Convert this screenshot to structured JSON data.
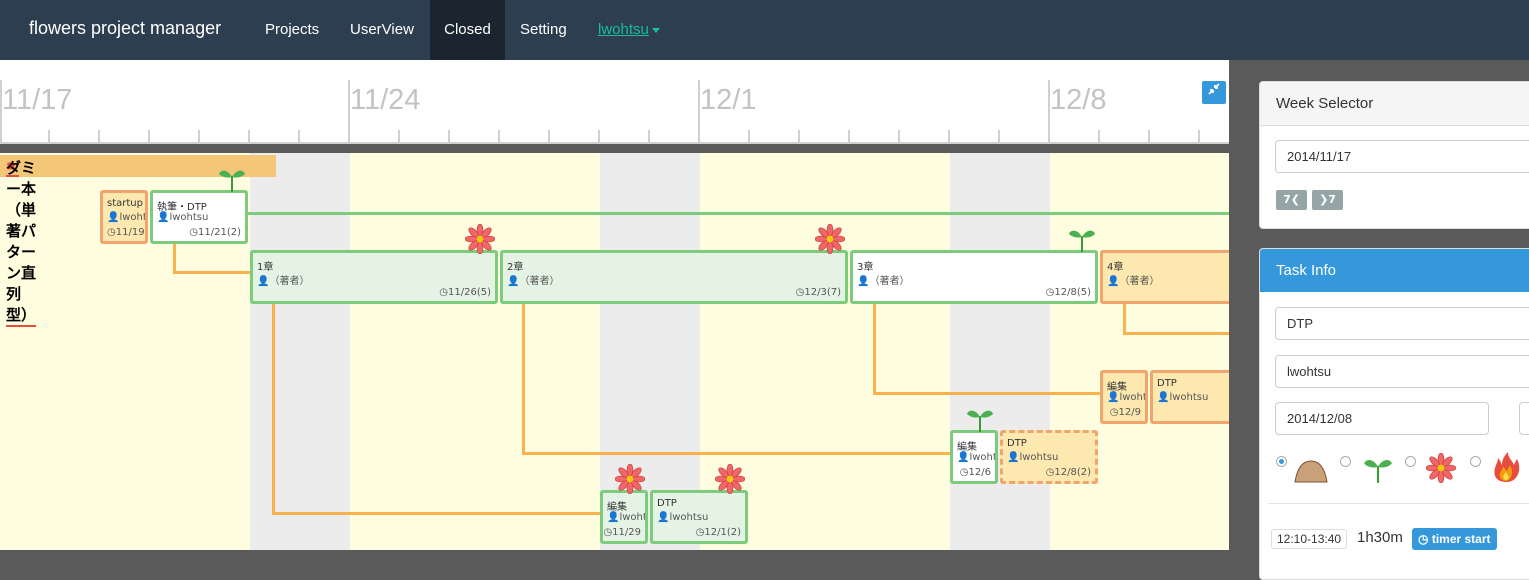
{
  "navbar": {
    "brand": "flowers project manager",
    "items": [
      "Projects",
      "UserView",
      "Closed",
      "Setting"
    ],
    "active": "Closed",
    "user": "lwohtsu"
  },
  "timeline": {
    "weeks": [
      "11/17",
      "11/24",
      "12/1",
      "12/8"
    ],
    "project_title": "ダミー本（単著パターン直列型）",
    "project_icon": "pointing-hand-icon",
    "expand_icon": "compress-arrows-icon",
    "tasks": [
      {
        "title": "startup",
        "user": "lwohts",
        "date": "11/19"
      },
      {
        "title": "執筆・DTP",
        "user": "lwohtsu",
        "date": "11/21(2)"
      },
      {
        "title": "1章",
        "user": "（著者）",
        "date": "11/26(5)"
      },
      {
        "title": "2章",
        "user": "（著者）",
        "date": "12/3(7)"
      },
      {
        "title": "3章",
        "user": "（著者）",
        "date": "12/8(5)"
      },
      {
        "title": "4章",
        "user": "（著者）",
        "date": ""
      },
      {
        "title": "編集",
        "user": "lwohts",
        "date": "12/9"
      },
      {
        "title": "DTP",
        "user": "lwohtsu",
        "date": ""
      },
      {
        "title": "編集",
        "user": "lwohts",
        "date": "12/6"
      },
      {
        "title": "DTP",
        "user": "lwohtsu",
        "date": "12/8(2)"
      },
      {
        "title": "編集",
        "user": "lwohts",
        "date": "11/29"
      },
      {
        "title": "DTP",
        "user": "lwohtsu",
        "date": "12/1(2)"
      }
    ],
    "status_icons": [
      "sprout-icon",
      "flower-icon"
    ]
  },
  "week_selector": {
    "title": "Week Selector",
    "date_value": "2014/11/17",
    "prev_label": "7",
    "next_label": "7"
  },
  "task_info": {
    "title": "Task Info",
    "task_name": "DTP",
    "user": "lwohtsu",
    "date": "2014/12/08",
    "status_options": [
      "mound-icon",
      "sprout-icon",
      "flower-icon",
      "fire-icon"
    ],
    "selected_status": "mound-icon",
    "time_range": "12:10-13:40",
    "duration": "1h30m",
    "timer_label": "timer start"
  },
  "colors": {
    "navbar": "#2c3e50",
    "accent": "#3498db",
    "link": "#1abc9c",
    "done_border": "#7dcc7d",
    "pending_border": "#f1a46c",
    "pending_fill": "#fde8b0"
  }
}
